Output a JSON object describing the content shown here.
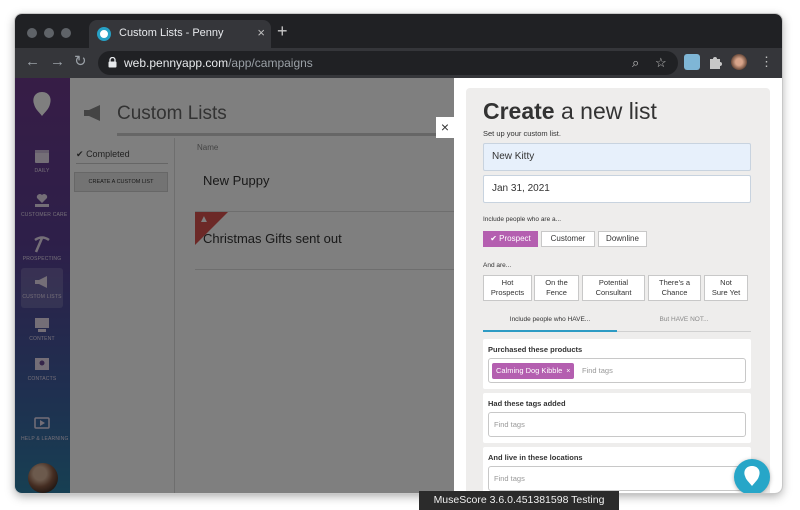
{
  "browser": {
    "tab_title": "Custom Lists - Penny",
    "url_host": "web.pennyapp.com",
    "url_path": "/app/campaigns",
    "new_tab_symbol": "+",
    "close_symbol": "×",
    "back_symbol": "←",
    "forward_symbol": "→",
    "reload_symbol": "↻",
    "search_symbol": "⌕",
    "star_symbol": "☆",
    "menu_symbol": "⋮"
  },
  "sidebar": {
    "items": [
      {
        "label": "DAILY",
        "icon": "calendar-icon"
      },
      {
        "label": "CUSTOMER CARE",
        "icon": "heart-hand-icon"
      },
      {
        "label": "PROSPECTING",
        "icon": "pickaxe-icon"
      },
      {
        "label": "CUSTOM LISTS",
        "icon": "megaphone-icon"
      },
      {
        "label": "CONTENT",
        "icon": "content-icon"
      },
      {
        "label": "CONTACTS",
        "icon": "contacts-icon"
      },
      {
        "label": "HELP & LEARNING",
        "icon": "video-icon"
      }
    ]
  },
  "page": {
    "title": "Custom Lists",
    "completed_label": "Completed",
    "create_button": "CREATE A CUSTOM LIST",
    "column_name": "Name",
    "lists": [
      "New Puppy",
      "Christmas Gifts sent out"
    ]
  },
  "panel": {
    "title_bold": "Create",
    "title_rest": " a new list",
    "subtitle": "Set up your custom list.",
    "name_value": "New Kitty",
    "date_value": "Jan 31, 2021",
    "include_label": "Include people who are a...",
    "people_types": [
      {
        "label": "Prospect",
        "selected": true
      },
      {
        "label": "Customer",
        "selected": false
      },
      {
        "label": "Downline",
        "selected": false
      }
    ],
    "and_are_label": "And are...",
    "statuses": [
      {
        "line1": "Hot",
        "line2": "Prospects"
      },
      {
        "line1": "On the",
        "line2": "Fence"
      },
      {
        "line1": "Potential",
        "line2": "Consultant"
      },
      {
        "line1": "There's a",
        "line2": "Chance"
      },
      {
        "line1": "Not",
        "line2": "Sure Yet"
      }
    ],
    "tab_have": "Include people who HAVE...",
    "tab_have_not": "But HAVE NOT...",
    "purchased_title": "Purchased these products",
    "purchased_tag": "Calming Dog Kibble",
    "find_tags": "Find tags",
    "tags_added_title": "Had these tags added",
    "locations_title": "And live in these locations",
    "tag_remove_symbol": "×",
    "check_symbol": "✔"
  },
  "os": {
    "bottom_bar": "MuseScore 3.6.0.451381598 Testing"
  },
  "colors": {
    "accent_purple": "#b45fb0",
    "accent_blue": "#2e9bc4",
    "badge_red": "#d9534f"
  }
}
